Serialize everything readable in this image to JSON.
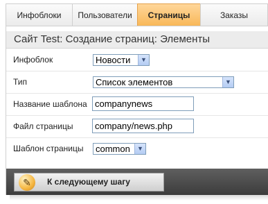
{
  "tabs": [
    {
      "label": "Инфоблоки",
      "active": false
    },
    {
      "label": "Пользователи",
      "active": false
    },
    {
      "label": "Страницы",
      "active": true
    },
    {
      "label": "Заказы",
      "active": false
    }
  ],
  "panel": {
    "title": "Сайт Test: Создание страниц: Элементы"
  },
  "form": {
    "iblock": {
      "label": "Инфоблок",
      "value": "Новости"
    },
    "type": {
      "label": "Тип",
      "value": "Список элементов"
    },
    "template_name": {
      "label": "Название шаблона",
      "value": "companynews"
    },
    "page_file": {
      "label": "Файл страницы",
      "value": "company/news.php"
    },
    "page_template": {
      "label": "Шаблон страницы",
      "value": "common"
    }
  },
  "next_button": {
    "label": "К следующему шагу",
    "icon": "pencil-icon"
  },
  "colors": {
    "active_tab": "#f8b859",
    "button_bar": "#3c3c3c"
  }
}
